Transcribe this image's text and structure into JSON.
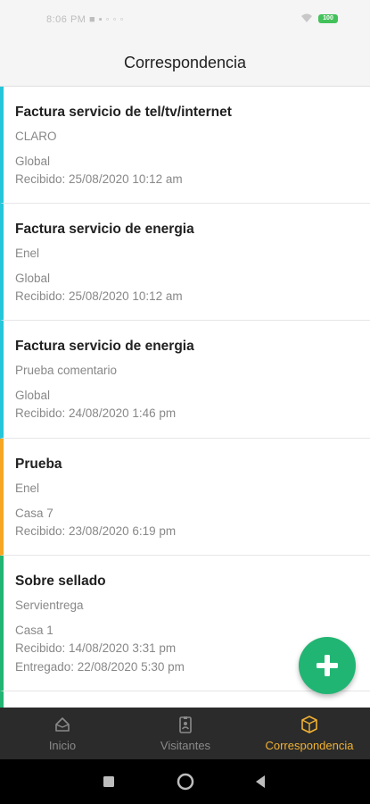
{
  "status_bar": {
    "left_text": "8:06 PM ■ ▪ ◦ ◦ ◦",
    "battery": "100"
  },
  "header": {
    "title": "Correspondencia"
  },
  "items": [
    {
      "title": "Factura servicio de tel/tv/internet",
      "sender": "CLARO",
      "location": "Global",
      "received": "Recibido: 25/08/2020 10:12 am",
      "accent": "#26c6da"
    },
    {
      "title": "Factura servicio de energia",
      "sender": "Enel",
      "location": "Global",
      "received": "Recibido: 25/08/2020 10:12 am",
      "accent": "#26c6da"
    },
    {
      "title": "Factura servicio de energia",
      "sender": "Prueba comentario",
      "location": "Global",
      "received": "Recibido: 24/08/2020 1:46 pm",
      "accent": "#26c6da"
    },
    {
      "title": "Prueba",
      "sender": "Enel",
      "location": "Casa 7",
      "received": "Recibido: 23/08/2020 6:19 pm",
      "accent": "#f5a623"
    },
    {
      "title": "Sobre sellado",
      "sender": "Servientrega",
      "location": "Casa 1",
      "received": "Recibido: 14/08/2020 3:31 pm",
      "delivered": "Entregado: 22/08/2020 5:30 pm",
      "accent": "#21b573"
    }
  ],
  "fab": {
    "icon": "plus-icon",
    "color": "#21b573"
  },
  "bottom_nav": [
    {
      "label": "Inicio",
      "icon": "home-icon"
    },
    {
      "label": "Visitantes",
      "icon": "badge-icon"
    },
    {
      "label": "Correspondencia",
      "icon": "package-icon",
      "active": true
    }
  ],
  "colors": {
    "active_tab": "#f2b233",
    "nav_bg": "#2b2b2b"
  }
}
